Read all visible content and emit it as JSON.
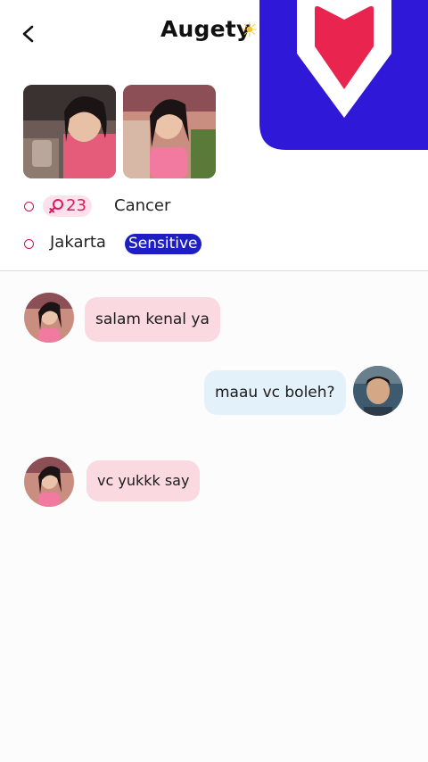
{
  "header": {
    "title": "Augety",
    "title_emoji": "☀",
    "back_icon": "chevron-left-icon",
    "logo_icon": "heart-shield-logo"
  },
  "profile": {
    "age": "23",
    "age_icon": "female-symbol-icon",
    "zodiac": "Cancer",
    "city": "Jakarta",
    "tag": "Sensitive"
  },
  "messages": [
    {
      "side": "in",
      "text": "salam kenal ya"
    },
    {
      "side": "out",
      "text": "maau vc boleh?"
    },
    {
      "side": "in",
      "text": "vc yukkk say"
    }
  ],
  "colors": {
    "brand_blue": "#2f18d8",
    "brand_red": "#e8244f",
    "incoming_bubble": "#fad9e1",
    "outgoing_bubble": "#e3f1fb",
    "age_badge_bg": "#fde0ea",
    "sensitive_badge_bg": "#1d1fc4"
  }
}
